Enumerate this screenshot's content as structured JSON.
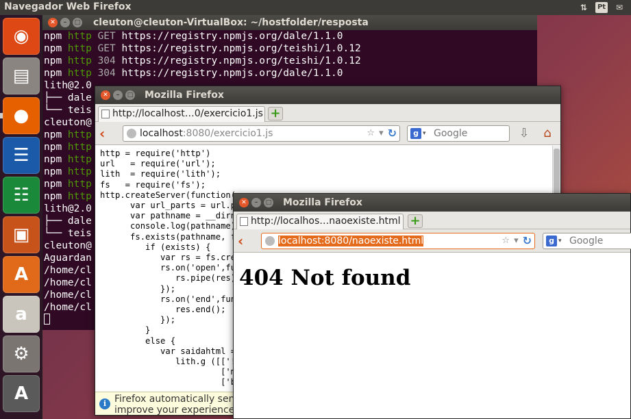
{
  "topbar": {
    "app_title": "Navegador Web Firefox",
    "lang": "Pt",
    "sort_icon": "⇅"
  },
  "launcher": {
    "items": [
      {
        "name": "ubuntu",
        "glyph": "◉",
        "color": "#dd4814"
      },
      {
        "name": "files",
        "glyph": "▤",
        "color": "#8a8580"
      },
      {
        "name": "firefox",
        "glyph": "●",
        "color": "#e66000"
      },
      {
        "name": "writer",
        "glyph": "☰",
        "color": "#1a5aa8"
      },
      {
        "name": "calc",
        "glyph": "☷",
        "color": "#1a8a3a"
      },
      {
        "name": "impress",
        "glyph": "▣",
        "color": "#c8531a"
      },
      {
        "name": "software-center",
        "glyph": "A",
        "color": "#e06a1a"
      },
      {
        "name": "amazon",
        "glyph": "a",
        "color": "#c9c5bd"
      },
      {
        "name": "system-settings",
        "glyph": "⚙",
        "color": "#7a7570"
      },
      {
        "name": "updater",
        "glyph": "A",
        "color": "#5a5a5a"
      }
    ]
  },
  "terminal": {
    "title": "cleuton@cleuton-VirtualBox: ~/hostfolder/resposta",
    "lines": [
      [
        "npm ",
        "http ",
        "GET https://registry.npmjs.org/dale/1.1.0"
      ],
      [
        "npm ",
        "http ",
        "GET https://registry.npmjs.org/teishi/1.0.12"
      ],
      [
        "npm ",
        "http ",
        "304 https://registry.npmjs.org/teishi/1.0.12"
      ],
      [
        "npm ",
        "http ",
        "304 https://registry.npmjs.org/dale/1.1.0"
      ],
      [
        "",
        "",
        "lith@2.0"
      ],
      [
        "",
        "",
        "├── dale"
      ],
      [
        "",
        "",
        "└── teis"
      ],
      [
        "",
        "",
        "cleuton@"
      ],
      [
        "npm ",
        "http",
        ""
      ],
      [
        "npm ",
        "http",
        ""
      ],
      [
        "npm ",
        "http",
        ""
      ],
      [
        "npm ",
        "http",
        ""
      ],
      [
        "npm ",
        "http",
        ""
      ],
      [
        "npm ",
        "http",
        ""
      ],
      [
        "",
        "",
        "lith@2.0"
      ],
      [
        "",
        "",
        "├── dale"
      ],
      [
        "",
        "",
        "└── teis"
      ],
      [
        "",
        "",
        "cleuton@"
      ],
      [
        "",
        "",
        "Aguardan"
      ],
      [
        "",
        "",
        "/home/cl"
      ],
      [
        "",
        "",
        "/home/cl"
      ],
      [
        "",
        "",
        "/home/cl"
      ],
      [
        "",
        "",
        "/home/cl"
      ]
    ]
  },
  "firefox1": {
    "title": "Mozilla Firefox",
    "tab_label": "http://localhost…0/exercicio1.js",
    "url_host": "localhost",
    "url_rest": ":8080/exercicio1.js",
    "search_placeholder": "Google",
    "code": "http = require('http')\nurl   = require('url');\nlith  = require('lith');\nfs   = require('fs');\nhttp.createServer(function(r\n      var url_parts = url.pa\n      var pathname = __dirna\n      console.log(pathname);\n      fs.exists(pathname, fu\n         if (exists) {\n            var rs = fs.crea\n            rs.on('open',fun\n               rs.pipe(res);\n            });\n            rs.on('end',func\n               res.end();\n            });\n         }\n         else {\n            var saidahtml =\n               lith.g ([['!D\n                        ['me\n                        ['bo",
    "info_line1": "Firefox automatically send",
    "info_line2": "improve your experience."
  },
  "firefox2": {
    "title": "Mozilla Firefox",
    "tab_label": "http://localhos…naoexiste.html",
    "url": "localhost:8080/naoexiste.html",
    "search_placeholder": "Google",
    "heading": "404 Not found"
  }
}
